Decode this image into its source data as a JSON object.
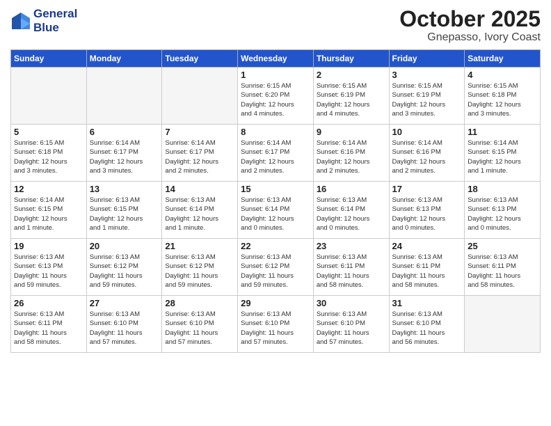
{
  "logo": {
    "line1": "General",
    "line2": "Blue"
  },
  "title": "October 2025",
  "subtitle": "Gnepasso, Ivory Coast",
  "days_of_week": [
    "Sunday",
    "Monday",
    "Tuesday",
    "Wednesday",
    "Thursday",
    "Friday",
    "Saturday"
  ],
  "weeks": [
    [
      {
        "day": "",
        "info": ""
      },
      {
        "day": "",
        "info": ""
      },
      {
        "day": "",
        "info": ""
      },
      {
        "day": "1",
        "info": "Sunrise: 6:15 AM\nSunset: 6:20 PM\nDaylight: 12 hours\nand 4 minutes."
      },
      {
        "day": "2",
        "info": "Sunrise: 6:15 AM\nSunset: 6:19 PM\nDaylight: 12 hours\nand 4 minutes."
      },
      {
        "day": "3",
        "info": "Sunrise: 6:15 AM\nSunset: 6:19 PM\nDaylight: 12 hours\nand 3 minutes."
      },
      {
        "day": "4",
        "info": "Sunrise: 6:15 AM\nSunset: 6:18 PM\nDaylight: 12 hours\nand 3 minutes."
      }
    ],
    [
      {
        "day": "5",
        "info": "Sunrise: 6:15 AM\nSunset: 6:18 PM\nDaylight: 12 hours\nand 3 minutes."
      },
      {
        "day": "6",
        "info": "Sunrise: 6:14 AM\nSunset: 6:17 PM\nDaylight: 12 hours\nand 3 minutes."
      },
      {
        "day": "7",
        "info": "Sunrise: 6:14 AM\nSunset: 6:17 PM\nDaylight: 12 hours\nand 2 minutes."
      },
      {
        "day": "8",
        "info": "Sunrise: 6:14 AM\nSunset: 6:17 PM\nDaylight: 12 hours\nand 2 minutes."
      },
      {
        "day": "9",
        "info": "Sunrise: 6:14 AM\nSunset: 6:16 PM\nDaylight: 12 hours\nand 2 minutes."
      },
      {
        "day": "10",
        "info": "Sunrise: 6:14 AM\nSunset: 6:16 PM\nDaylight: 12 hours\nand 2 minutes."
      },
      {
        "day": "11",
        "info": "Sunrise: 6:14 AM\nSunset: 6:15 PM\nDaylight: 12 hours\nand 1 minute."
      }
    ],
    [
      {
        "day": "12",
        "info": "Sunrise: 6:14 AM\nSunset: 6:15 PM\nDaylight: 12 hours\nand 1 minute."
      },
      {
        "day": "13",
        "info": "Sunrise: 6:13 AM\nSunset: 6:15 PM\nDaylight: 12 hours\nand 1 minute."
      },
      {
        "day": "14",
        "info": "Sunrise: 6:13 AM\nSunset: 6:14 PM\nDaylight: 12 hours\nand 1 minute."
      },
      {
        "day": "15",
        "info": "Sunrise: 6:13 AM\nSunset: 6:14 PM\nDaylight: 12 hours\nand 0 minutes."
      },
      {
        "day": "16",
        "info": "Sunrise: 6:13 AM\nSunset: 6:14 PM\nDaylight: 12 hours\nand 0 minutes."
      },
      {
        "day": "17",
        "info": "Sunrise: 6:13 AM\nSunset: 6:13 PM\nDaylight: 12 hours\nand 0 minutes."
      },
      {
        "day": "18",
        "info": "Sunrise: 6:13 AM\nSunset: 6:13 PM\nDaylight: 12 hours\nand 0 minutes."
      }
    ],
    [
      {
        "day": "19",
        "info": "Sunrise: 6:13 AM\nSunset: 6:13 PM\nDaylight: 11 hours\nand 59 minutes."
      },
      {
        "day": "20",
        "info": "Sunrise: 6:13 AM\nSunset: 6:12 PM\nDaylight: 11 hours\nand 59 minutes."
      },
      {
        "day": "21",
        "info": "Sunrise: 6:13 AM\nSunset: 6:12 PM\nDaylight: 11 hours\nand 59 minutes."
      },
      {
        "day": "22",
        "info": "Sunrise: 6:13 AM\nSunset: 6:12 PM\nDaylight: 11 hours\nand 59 minutes."
      },
      {
        "day": "23",
        "info": "Sunrise: 6:13 AM\nSunset: 6:11 PM\nDaylight: 11 hours\nand 58 minutes."
      },
      {
        "day": "24",
        "info": "Sunrise: 6:13 AM\nSunset: 6:11 PM\nDaylight: 11 hours\nand 58 minutes."
      },
      {
        "day": "25",
        "info": "Sunrise: 6:13 AM\nSunset: 6:11 PM\nDaylight: 11 hours\nand 58 minutes."
      }
    ],
    [
      {
        "day": "26",
        "info": "Sunrise: 6:13 AM\nSunset: 6:11 PM\nDaylight: 11 hours\nand 58 minutes."
      },
      {
        "day": "27",
        "info": "Sunrise: 6:13 AM\nSunset: 6:10 PM\nDaylight: 11 hours\nand 57 minutes."
      },
      {
        "day": "28",
        "info": "Sunrise: 6:13 AM\nSunset: 6:10 PM\nDaylight: 11 hours\nand 57 minutes."
      },
      {
        "day": "29",
        "info": "Sunrise: 6:13 AM\nSunset: 6:10 PM\nDaylight: 11 hours\nand 57 minutes."
      },
      {
        "day": "30",
        "info": "Sunrise: 6:13 AM\nSunset: 6:10 PM\nDaylight: 11 hours\nand 57 minutes."
      },
      {
        "day": "31",
        "info": "Sunrise: 6:13 AM\nSunset: 6:10 PM\nDaylight: 11 hours\nand 56 minutes."
      },
      {
        "day": "",
        "info": ""
      }
    ]
  ]
}
